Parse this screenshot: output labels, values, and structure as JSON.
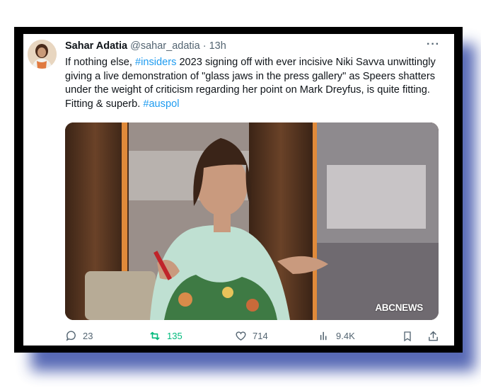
{
  "tweet": {
    "author_name": "Sahar Adatia",
    "handle": "@sahar_adatia",
    "time": "· 13h",
    "text": [
      {
        "t": "If nothing else, ",
        "tag": false
      },
      {
        "t": "#insiders",
        "tag": true
      },
      {
        "t": " 2023 signing off with ever incisive Niki Savva unwittingly giving a live demonstration of \"glass jaws in the press gallery\" as Speers shatters under the weight of criticism regarding her point on Mark Dreyfus, is quite fitting. Fitting & superb. ",
        "tag": false
      },
      {
        "t": "#auspol",
        "tag": true
      }
    ],
    "media_logo": "NEWS",
    "more_label": "···"
  },
  "actions": {
    "replies": "23",
    "retweets": "135",
    "likes": "714",
    "views": "9.4K"
  },
  "colors": {
    "link": "#1d9bf0",
    "retweet": "#00ba7c",
    "muted": "#536471",
    "frame": "#000000",
    "shadow": "#3a4fa8"
  },
  "icons": [
    "reply-icon",
    "retweet-icon",
    "like-icon",
    "views-icon",
    "bookmark-icon",
    "share-icon",
    "more-icon"
  ]
}
